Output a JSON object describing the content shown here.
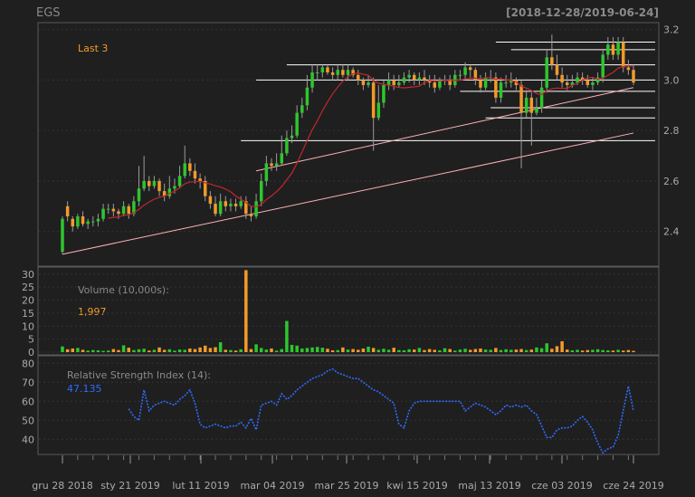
{
  "header": {
    "symbol": "EGS",
    "range": "[2018-12-28/2019-06-24]"
  },
  "legend": {
    "last_label": "Last 3",
    "volume_label": "Volume (10,000s):",
    "volume_value": "1,997",
    "rsi_label": "Relative Strength Index (14):",
    "rsi_value": "47.135"
  },
  "colors": {
    "up": "#2ec62e",
    "down": "#f39a2a",
    "ma": "#c0282d",
    "rsi": "#2f6bff",
    "trend": "#ffb0b8",
    "level": "#ffffff",
    "accent": "#f39a2a"
  },
  "x_axis": {
    "labels": [
      "gru 28 2018",
      "sty 21 2019",
      "lut 11 2019",
      "mar 04 2019",
      "mar 25 2019",
      "kwi 15 2019",
      "maj 13 2019",
      "cze 03 2019",
      "cze 24 2019"
    ]
  },
  "chart_data": [
    {
      "type": "candlestick",
      "title": "EGS",
      "y_ticks": [
        2.4,
        2.6,
        2.8,
        3.0,
        3.2
      ],
      "ylim": [
        2.27,
        3.22
      ],
      "grid": true,
      "open": [
        2.32,
        2.5,
        2.45,
        2.42,
        2.46,
        2.43,
        2.44,
        2.44,
        2.45,
        2.49,
        2.49,
        2.48,
        2.47,
        2.5,
        2.47,
        2.52,
        2.57,
        2.6,
        2.58,
        2.6,
        2.56,
        2.54,
        2.57,
        2.58,
        2.62,
        2.67,
        2.64,
        2.61,
        2.6,
        2.54,
        2.51,
        2.47,
        2.52,
        2.5,
        2.51,
        2.5,
        2.52,
        2.47,
        2.46,
        2.52,
        2.6,
        2.67,
        2.66,
        2.67,
        2.71,
        2.77,
        2.78,
        2.87,
        2.9,
        2.97,
        3.03,
        3.03,
        3.05,
        3.03,
        3.02,
        3.04,
        3.02,
        3.04,
        3.02,
        3.0,
        2.98,
        2.99,
        2.85,
        2.91,
        2.98,
        3.0,
        2.98,
        2.99,
        3.01,
        3.02,
        3.0,
        3.01,
        3.0,
        2.99,
        2.97,
        3.0,
        3.0,
        2.98,
        3.02,
        3.02,
        3.05,
        3.04,
        3.0,
        2.97,
        3.01,
        3.01,
        2.93,
        2.99,
        2.99,
        3.0,
        2.98,
        2.87,
        2.93,
        2.87,
        2.89,
        2.97,
        3.09,
        3.06,
        3.02,
        2.99,
        2.98,
        2.99,
        3.01,
        3.0,
        2.98,
        2.99,
        3.01,
        3.1,
        3.14,
        3.1,
        3.15,
        3.05,
        3.04
      ],
      "close": [
        2.45,
        2.46,
        2.42,
        2.46,
        2.43,
        2.44,
        2.44,
        2.45,
        2.49,
        2.49,
        2.48,
        2.47,
        2.5,
        2.47,
        2.52,
        2.57,
        2.6,
        2.58,
        2.6,
        2.56,
        2.54,
        2.57,
        2.58,
        2.62,
        2.67,
        2.64,
        2.61,
        2.6,
        2.54,
        2.51,
        2.47,
        2.52,
        2.5,
        2.51,
        2.5,
        2.52,
        2.47,
        2.46,
        2.52,
        2.6,
        2.67,
        2.66,
        2.67,
        2.71,
        2.77,
        2.78,
        2.87,
        2.9,
        2.97,
        3.03,
        3.03,
        3.05,
        3.03,
        3.02,
        3.04,
        3.02,
        3.04,
        3.02,
        3.0,
        2.98,
        2.99,
        2.85,
        2.91,
        2.98,
        3.0,
        2.98,
        2.99,
        3.01,
        3.02,
        3.0,
        3.01,
        3.0,
        2.99,
        2.97,
        3.0,
        3.0,
        2.98,
        3.02,
        3.02,
        3.05,
        3.04,
        3.0,
        2.97,
        3.01,
        3.01,
        2.93,
        2.99,
        2.99,
        3.0,
        2.98,
        2.87,
        2.93,
        2.87,
        2.89,
        2.97,
        3.09,
        3.06,
        3.02,
        2.99,
        2.98,
        2.99,
        3.01,
        3.0,
        2.98,
        2.99,
        3.01,
        3.1,
        3.14,
        3.1,
        3.15,
        3.05,
        3.04,
        2.99
      ],
      "high": [
        2.46,
        2.52,
        2.46,
        2.47,
        2.48,
        2.45,
        2.46,
        2.47,
        2.51,
        2.51,
        2.51,
        2.49,
        2.52,
        2.51,
        2.54,
        2.66,
        2.7,
        2.62,
        2.62,
        2.61,
        2.59,
        2.62,
        2.61,
        2.66,
        2.74,
        2.69,
        2.67,
        2.63,
        2.62,
        2.56,
        2.54,
        2.55,
        2.54,
        2.53,
        2.53,
        2.54,
        2.54,
        2.5,
        2.55,
        2.63,
        2.7,
        2.69,
        2.71,
        2.78,
        2.8,
        2.82,
        2.9,
        2.93,
        3.02,
        3.06,
        3.06,
        3.06,
        3.06,
        3.05,
        3.06,
        3.06,
        3.06,
        3.05,
        3.04,
        3.01,
        3.02,
        3.01,
        2.98,
        3.0,
        3.03,
        3.02,
        3.02,
        3.03,
        3.04,
        3.03,
        3.03,
        3.04,
        3.02,
        3.02,
        3.01,
        3.02,
        3.02,
        3.04,
        3.04,
        3.07,
        3.06,
        3.05,
        3.02,
        3.03,
        3.04,
        3.03,
        3.01,
        3.02,
        3.03,
        3.01,
        3.0,
        2.96,
        2.95,
        2.93,
        3.0,
        3.12,
        3.18,
        3.1,
        3.05,
        3.02,
        3.02,
        3.03,
        3.03,
        3.02,
        3.01,
        3.03,
        3.12,
        3.17,
        3.17,
        3.17,
        3.17,
        3.08,
        3.06
      ],
      "low": [
        2.31,
        2.44,
        2.4,
        2.41,
        2.42,
        2.41,
        2.42,
        2.42,
        2.44,
        2.47,
        2.46,
        2.45,
        2.46,
        2.45,
        2.46,
        2.5,
        2.56,
        2.56,
        2.57,
        2.54,
        2.52,
        2.53,
        2.55,
        2.57,
        2.61,
        2.62,
        2.59,
        2.57,
        2.52,
        2.49,
        2.46,
        2.46,
        2.48,
        2.48,
        2.48,
        2.49,
        2.45,
        2.44,
        2.45,
        2.5,
        2.58,
        2.64,
        2.64,
        2.66,
        2.7,
        2.75,
        2.77,
        2.85,
        2.88,
        2.95,
        3.0,
        3.01,
        3.02,
        3.0,
        3.0,
        3.01,
        3.0,
        3.01,
        2.98,
        2.96,
        2.97,
        2.72,
        2.84,
        2.89,
        2.96,
        2.96,
        2.97,
        2.98,
        2.99,
        2.98,
        2.98,
        2.98,
        2.97,
        2.95,
        2.96,
        2.98,
        2.96,
        2.97,
        3.0,
        3.0,
        3.01,
        2.98,
        2.95,
        2.96,
        2.99,
        2.91,
        2.91,
        2.97,
        2.97,
        2.96,
        2.65,
        2.85,
        2.74,
        2.86,
        2.87,
        2.95,
        3.04,
        3.0,
        2.97,
        2.96,
        2.97,
        2.98,
        2.98,
        2.97,
        2.96,
        2.98,
        2.99,
        3.08,
        3.08,
        3.08,
        3.03,
        3.02,
        2.98
      ],
      "ma_series": [
        null,
        null,
        null,
        null,
        null,
        null,
        null,
        null,
        null,
        null,
        null,
        null,
        null,
        null,
        null,
        null,
        null,
        null,
        null,
        null,
        null,
        null,
        null,
        null,
        null,
        null,
        null,
        null,
        null,
        null,
        null,
        null,
        null,
        null,
        null,
        null,
        null,
        null,
        null,
        null,
        null,
        null,
        null,
        null,
        null,
        null,
        null,
        null,
        null,
        null,
        null,
        null,
        null,
        null,
        null,
        null,
        null,
        null,
        null,
        null,
        null,
        null,
        null,
        null,
        null,
        null,
        null,
        null,
        null,
        null,
        null,
        null,
        null,
        null,
        null,
        null,
        null,
        null,
        null,
        null,
        null,
        null,
        null,
        null,
        null,
        null,
        null,
        null,
        null,
        null,
        null,
        null,
        null,
        null,
        null,
        null,
        null,
        null,
        null,
        null,
        null,
        null,
        null,
        null,
        null,
        null,
        null,
        null,
        null,
        null,
        null,
        null,
        null
      ],
      "levels": [
        {
          "value": 3.15,
          "from": 85
        },
        {
          "value": 3.12,
          "from": 88
        },
        {
          "value": 3.06,
          "from": 44
        },
        {
          "value": 3.0,
          "from": 38
        },
        {
          "value": 2.955,
          "from": 78
        },
        {
          "value": 2.89,
          "from": 84
        },
        {
          "value": 2.85,
          "from": 83
        },
        {
          "value": 2.76,
          "from": 35
        }
      ],
      "trendlines": [
        {
          "from": [
            0,
            2.31
          ],
          "to": [
            112,
            2.79
          ]
        },
        {
          "from": [
            38,
            2.64
          ],
          "to": [
            112,
            2.97
          ]
        }
      ]
    },
    {
      "type": "bar",
      "title": "Volume (10,000s)",
      "y_ticks": [
        0,
        5,
        10,
        15,
        20,
        25,
        30
      ],
      "ylim": [
        0,
        32
      ],
      "values": [
        2.2,
        1.1,
        1.4,
        1.6,
        0.9,
        0.6,
        0.8,
        0.7,
        0.5,
        0.6,
        1.2,
        0.8,
        2.6,
        1.7,
        0.8,
        1.1,
        1.3,
        0.6,
        0.9,
        1.8,
        0.9,
        1.1,
        0.6,
        1.0,
        0.9,
        1.4,
        1.2,
        1.8,
        2.5,
        1.6,
        1.9,
        3.8,
        0.9,
        0.8,
        0.6,
        1.1,
        31.5,
        1.2,
        3.0,
        1.6,
        1.0,
        1.4,
        0.6,
        1.2,
        12.0,
        2.8,
        2.5,
        1.4,
        1.6,
        1.8,
        2.0,
        1.7,
        1.3,
        0.7,
        0.8,
        1.8,
        1.0,
        1.2,
        0.9,
        1.4,
        2.1,
        1.6,
        0.9,
        1.3,
        0.9,
        1.7,
        0.8,
        0.7,
        1.1,
        1.0,
        1.6,
        0.8,
        1.2,
        0.9,
        0.7,
        1.5,
        1.2,
        0.6,
        1.0,
        1.3,
        0.9,
        1.2,
        1.4,
        1.0,
        0.9,
        1.6,
        0.8,
        1.1,
        0.9,
        1.0,
        1.2,
        0.8,
        1.0,
        1.8,
        1.5,
        3.4,
        1.3,
        2.3,
        4.2,
        1.0,
        0.7,
        0.9,
        0.6,
        0.8,
        0.9,
        1.1,
        0.8,
        0.7,
        0.6,
        0.9,
        0.6,
        0.8,
        0.5
      ]
    },
    {
      "type": "line",
      "title": "Relative Strength Index (14)",
      "y_ticks": [
        40,
        50,
        60,
        70,
        80
      ],
      "ylim": [
        33,
        83
      ],
      "start_index": 13,
      "values": [
        56,
        52,
        50,
        66,
        55,
        58,
        59,
        60,
        59,
        58,
        61,
        63,
        66,
        59,
        48,
        46,
        47,
        48,
        47,
        46,
        47,
        47,
        49,
        46,
        51,
        45,
        58,
        59,
        60,
        58,
        64,
        61,
        63,
        66,
        68,
        70,
        72,
        73,
        74,
        76,
        77,
        75,
        74,
        73,
        72,
        72,
        70,
        68,
        66,
        65,
        63,
        61,
        59,
        48,
        46,
        55,
        59,
        60,
        60,
        60,
        60,
        60,
        60,
        60,
        60,
        60,
        55,
        57,
        59,
        58,
        57,
        55,
        53,
        55,
        58,
        57,
        58,
        57,
        58,
        55,
        53,
        47,
        41,
        41,
        45,
        46,
        46,
        47,
        50,
        52,
        49,
        45,
        38,
        33,
        35,
        36,
        42,
        55,
        68,
        55,
        55,
        54,
        51,
        50,
        49,
        52,
        48,
        50,
        48,
        51,
        52,
        54,
        57,
        60,
        67,
        67,
        66,
        47,
        52,
        48,
        47
      ]
    }
  ]
}
